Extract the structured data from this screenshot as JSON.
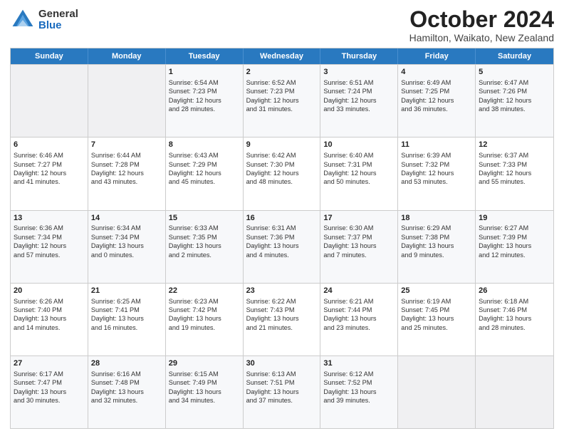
{
  "logo": {
    "general": "General",
    "blue": "Blue"
  },
  "title": {
    "month": "October 2024",
    "location": "Hamilton, Waikato, New Zealand"
  },
  "weekdays": [
    "Sunday",
    "Monday",
    "Tuesday",
    "Wednesday",
    "Thursday",
    "Friday",
    "Saturday"
  ],
  "rows": [
    [
      {
        "day": "",
        "lines": []
      },
      {
        "day": "",
        "lines": []
      },
      {
        "day": "1",
        "lines": [
          "Sunrise: 6:54 AM",
          "Sunset: 7:23 PM",
          "Daylight: 12 hours",
          "and 28 minutes."
        ]
      },
      {
        "day": "2",
        "lines": [
          "Sunrise: 6:52 AM",
          "Sunset: 7:23 PM",
          "Daylight: 12 hours",
          "and 31 minutes."
        ]
      },
      {
        "day": "3",
        "lines": [
          "Sunrise: 6:51 AM",
          "Sunset: 7:24 PM",
          "Daylight: 12 hours",
          "and 33 minutes."
        ]
      },
      {
        "day": "4",
        "lines": [
          "Sunrise: 6:49 AM",
          "Sunset: 7:25 PM",
          "Daylight: 12 hours",
          "and 36 minutes."
        ]
      },
      {
        "day": "5",
        "lines": [
          "Sunrise: 6:47 AM",
          "Sunset: 7:26 PM",
          "Daylight: 12 hours",
          "and 38 minutes."
        ]
      }
    ],
    [
      {
        "day": "6",
        "lines": [
          "Sunrise: 6:46 AM",
          "Sunset: 7:27 PM",
          "Daylight: 12 hours",
          "and 41 minutes."
        ]
      },
      {
        "day": "7",
        "lines": [
          "Sunrise: 6:44 AM",
          "Sunset: 7:28 PM",
          "Daylight: 12 hours",
          "and 43 minutes."
        ]
      },
      {
        "day": "8",
        "lines": [
          "Sunrise: 6:43 AM",
          "Sunset: 7:29 PM",
          "Daylight: 12 hours",
          "and 45 minutes."
        ]
      },
      {
        "day": "9",
        "lines": [
          "Sunrise: 6:42 AM",
          "Sunset: 7:30 PM",
          "Daylight: 12 hours",
          "and 48 minutes."
        ]
      },
      {
        "day": "10",
        "lines": [
          "Sunrise: 6:40 AM",
          "Sunset: 7:31 PM",
          "Daylight: 12 hours",
          "and 50 minutes."
        ]
      },
      {
        "day": "11",
        "lines": [
          "Sunrise: 6:39 AM",
          "Sunset: 7:32 PM",
          "Daylight: 12 hours",
          "and 53 minutes."
        ]
      },
      {
        "day": "12",
        "lines": [
          "Sunrise: 6:37 AM",
          "Sunset: 7:33 PM",
          "Daylight: 12 hours",
          "and 55 minutes."
        ]
      }
    ],
    [
      {
        "day": "13",
        "lines": [
          "Sunrise: 6:36 AM",
          "Sunset: 7:34 PM",
          "Daylight: 12 hours",
          "and 57 minutes."
        ]
      },
      {
        "day": "14",
        "lines": [
          "Sunrise: 6:34 AM",
          "Sunset: 7:34 PM",
          "Daylight: 13 hours",
          "and 0 minutes."
        ]
      },
      {
        "day": "15",
        "lines": [
          "Sunrise: 6:33 AM",
          "Sunset: 7:35 PM",
          "Daylight: 13 hours",
          "and 2 minutes."
        ]
      },
      {
        "day": "16",
        "lines": [
          "Sunrise: 6:31 AM",
          "Sunset: 7:36 PM",
          "Daylight: 13 hours",
          "and 4 minutes."
        ]
      },
      {
        "day": "17",
        "lines": [
          "Sunrise: 6:30 AM",
          "Sunset: 7:37 PM",
          "Daylight: 13 hours",
          "and 7 minutes."
        ]
      },
      {
        "day": "18",
        "lines": [
          "Sunrise: 6:29 AM",
          "Sunset: 7:38 PM",
          "Daylight: 13 hours",
          "and 9 minutes."
        ]
      },
      {
        "day": "19",
        "lines": [
          "Sunrise: 6:27 AM",
          "Sunset: 7:39 PM",
          "Daylight: 13 hours",
          "and 12 minutes."
        ]
      }
    ],
    [
      {
        "day": "20",
        "lines": [
          "Sunrise: 6:26 AM",
          "Sunset: 7:40 PM",
          "Daylight: 13 hours",
          "and 14 minutes."
        ]
      },
      {
        "day": "21",
        "lines": [
          "Sunrise: 6:25 AM",
          "Sunset: 7:41 PM",
          "Daylight: 13 hours",
          "and 16 minutes."
        ]
      },
      {
        "day": "22",
        "lines": [
          "Sunrise: 6:23 AM",
          "Sunset: 7:42 PM",
          "Daylight: 13 hours",
          "and 19 minutes."
        ]
      },
      {
        "day": "23",
        "lines": [
          "Sunrise: 6:22 AM",
          "Sunset: 7:43 PM",
          "Daylight: 13 hours",
          "and 21 minutes."
        ]
      },
      {
        "day": "24",
        "lines": [
          "Sunrise: 6:21 AM",
          "Sunset: 7:44 PM",
          "Daylight: 13 hours",
          "and 23 minutes."
        ]
      },
      {
        "day": "25",
        "lines": [
          "Sunrise: 6:19 AM",
          "Sunset: 7:45 PM",
          "Daylight: 13 hours",
          "and 25 minutes."
        ]
      },
      {
        "day": "26",
        "lines": [
          "Sunrise: 6:18 AM",
          "Sunset: 7:46 PM",
          "Daylight: 13 hours",
          "and 28 minutes."
        ]
      }
    ],
    [
      {
        "day": "27",
        "lines": [
          "Sunrise: 6:17 AM",
          "Sunset: 7:47 PM",
          "Daylight: 13 hours",
          "and 30 minutes."
        ]
      },
      {
        "day": "28",
        "lines": [
          "Sunrise: 6:16 AM",
          "Sunset: 7:48 PM",
          "Daylight: 13 hours",
          "and 32 minutes."
        ]
      },
      {
        "day": "29",
        "lines": [
          "Sunrise: 6:15 AM",
          "Sunset: 7:49 PM",
          "Daylight: 13 hours",
          "and 34 minutes."
        ]
      },
      {
        "day": "30",
        "lines": [
          "Sunrise: 6:13 AM",
          "Sunset: 7:51 PM",
          "Daylight: 13 hours",
          "and 37 minutes."
        ]
      },
      {
        "day": "31",
        "lines": [
          "Sunrise: 6:12 AM",
          "Sunset: 7:52 PM",
          "Daylight: 13 hours",
          "and 39 minutes."
        ]
      },
      {
        "day": "",
        "lines": []
      },
      {
        "day": "",
        "lines": []
      }
    ]
  ]
}
